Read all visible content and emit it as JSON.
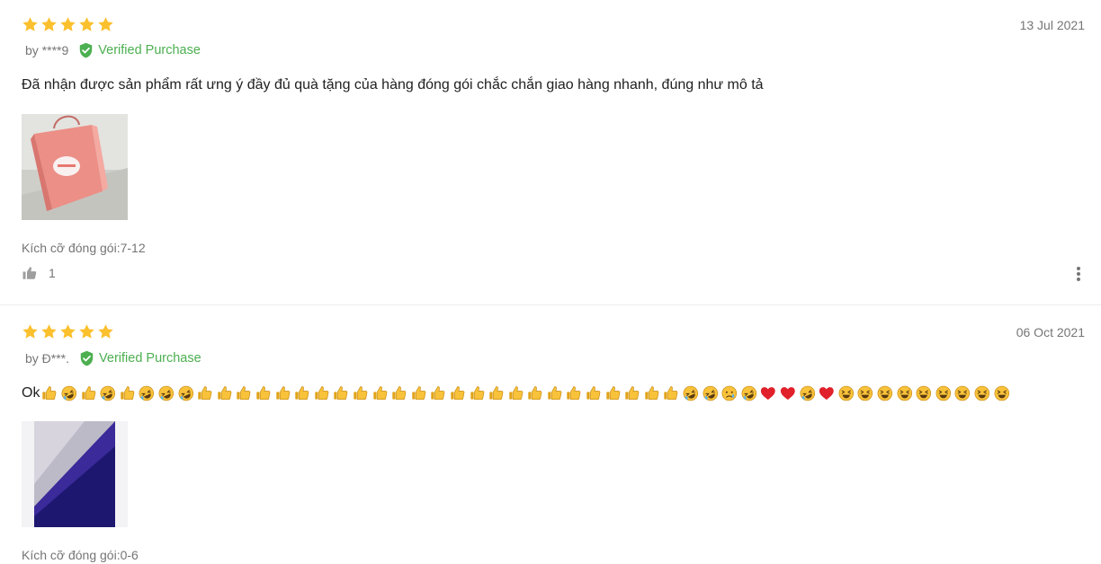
{
  "colors": {
    "star": "#fbc02d",
    "verified": "#4caf50",
    "muted_text": "#757575",
    "body_text": "#212121",
    "divider": "#eeeeee"
  },
  "reviews": [
    {
      "rating": 5,
      "date": "13 Jul 2021",
      "author": "by ****9",
      "verified_label": "Verified Purchase",
      "content": "Đã nhận được sản phẩm rất ưng ý đầy đủ quà tặng của hàng đóng gói chắc chắn giao hàng nhanh, đúng như mô tả",
      "photo_icon": "pink-gift-bag-photo",
      "sku": "Kích cỡ đóng gói:7-12",
      "likes": "1",
      "like_icon": "thumbs-up-icon",
      "more_icon": "more-vertical-icon"
    },
    {
      "rating": 5,
      "date": "06 Oct 2021",
      "author": "by Đ***.",
      "verified_label": "Verified Purchase",
      "content_text": "Ok",
      "content_emojis": [
        "thumbs-up",
        "rofl",
        "thumbs-up",
        "rofl",
        "thumbs-up",
        "rofl",
        "rofl",
        "rofl",
        "thumbs-up",
        "thumbs-up",
        "thumbs-up",
        "thumbs-up",
        "thumbs-up",
        "thumbs-up",
        "thumbs-up",
        "thumbs-up",
        "thumbs-up",
        "thumbs-up",
        "thumbs-up",
        "thumbs-up",
        "thumbs-up",
        "thumbs-up",
        "thumbs-up",
        "thumbs-up",
        "thumbs-up",
        "thumbs-up",
        "thumbs-up",
        "thumbs-up",
        "thumbs-up",
        "thumbs-up",
        "thumbs-up",
        "thumbs-up",
        "thumbs-up",
        "rofl",
        "rofl",
        "crying",
        "rofl",
        "heart",
        "heart",
        "rofl",
        "heart",
        "squint",
        "squint",
        "squint",
        "squint",
        "squint",
        "squint",
        "squint",
        "squint",
        "squint"
      ],
      "photo_icon": "fabric-closeup-photo",
      "sku": "Kích cỡ đóng gói:0-6"
    }
  ]
}
